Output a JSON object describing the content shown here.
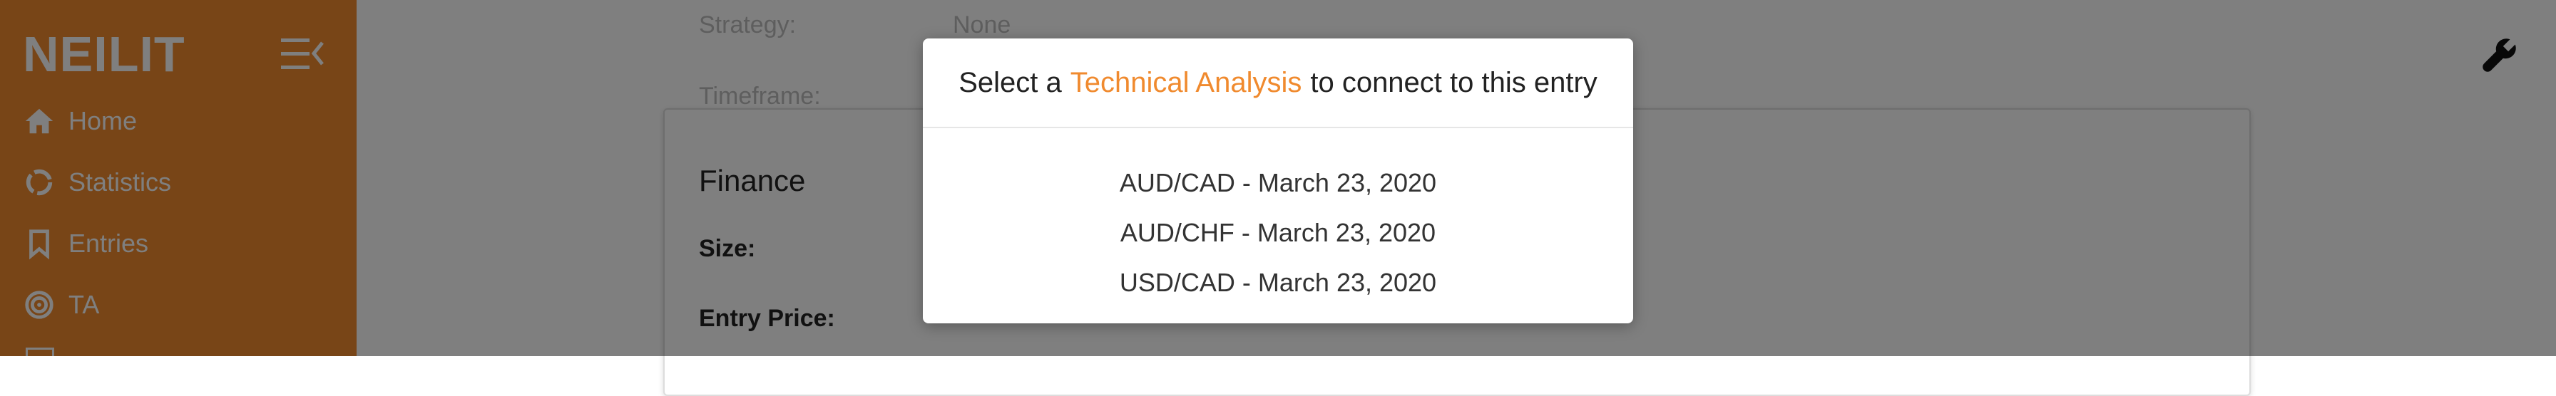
{
  "app": {
    "logo": "NEILIT"
  },
  "sidebar": {
    "items": [
      {
        "label": "Home",
        "icon": "home-icon"
      },
      {
        "label": "Statistics",
        "icon": "statistics-icon"
      },
      {
        "label": "Entries",
        "icon": "bookmark-icon"
      },
      {
        "label": "TA",
        "icon": "target-icon"
      }
    ]
  },
  "form": {
    "strategy_label": "Strategy:",
    "strategy_value": "None",
    "timeframe_label": "Timeframe:"
  },
  "card": {
    "title": "Finance",
    "size_label": "Size:",
    "entry_price_label": "Entry Price:"
  },
  "modal": {
    "title_prefix": "Select a",
    "title_accent": "Technical Analysis",
    "title_suffix": "to connect to this entry",
    "options": [
      "AUD/CAD - March 23, 2020",
      "AUD/CHF - March 23, 2020",
      "USD/CAD - March 23, 2020"
    ]
  },
  "colors": {
    "accent": "#f08a2e",
    "overlay": "rgba(0,0,0,0.5)"
  }
}
